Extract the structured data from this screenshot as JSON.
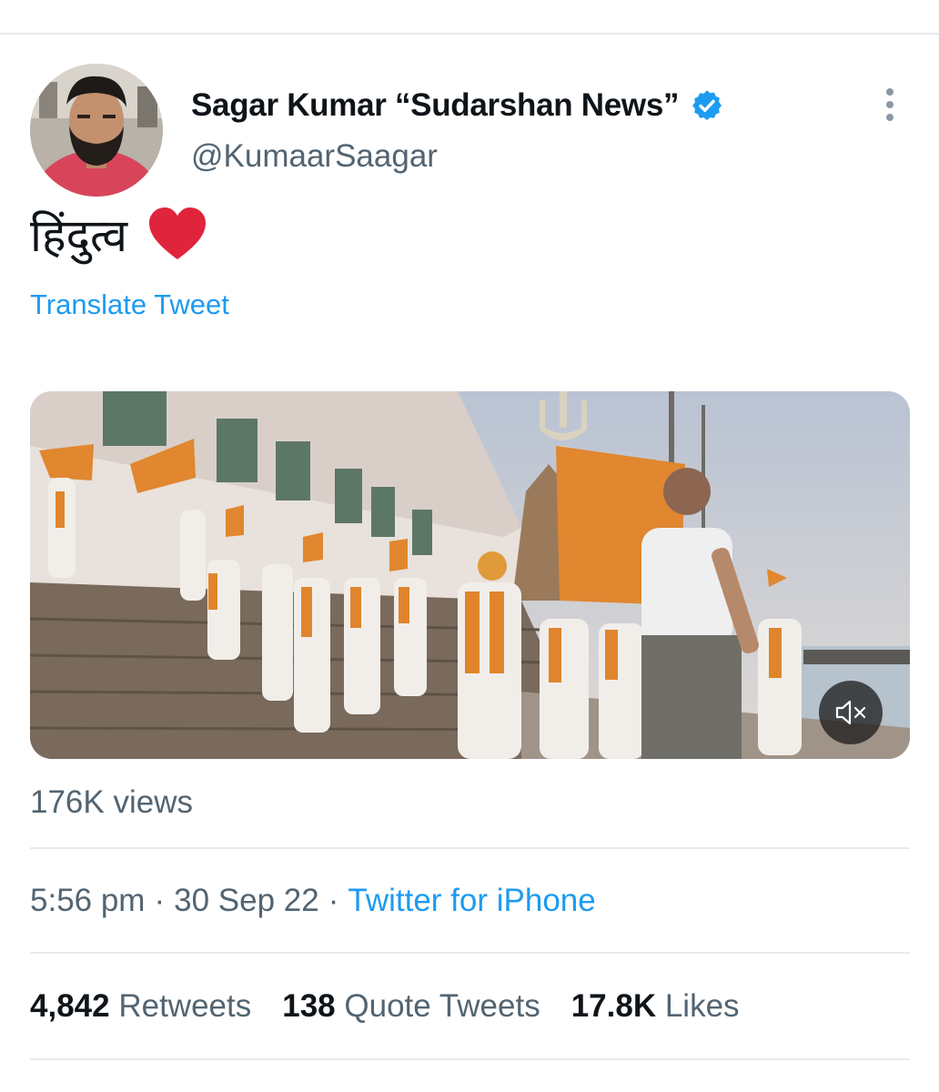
{
  "tweet": {
    "author": {
      "display_name": "Sagar Kumar “Sudarshan News”",
      "handle": "@KumaarSaagar",
      "verified": true,
      "verified_color": "#1d9bf0"
    },
    "text": "हिंदुत्व",
    "text_emoji": "red-heart-emoji",
    "translate_label": "Translate Tweet",
    "media": {
      "type": "video",
      "muted": true,
      "mute_icon": "speaker-muted-icon"
    },
    "views": "176K views",
    "time": "5:56 pm",
    "separator": "·",
    "date": "30 Sep 22",
    "source": "Twitter for iPhone",
    "stats": {
      "retweets_count": "4,842",
      "retweets_label": "Retweets",
      "quotes_count": "138",
      "quotes_label": "Quote Tweets",
      "likes_count": "17.8K",
      "likes_label": "Likes"
    }
  },
  "colors": {
    "link_blue": "#1d9bf0",
    "secondary_text": "#536471",
    "heart_red": "#e0243b",
    "divider": "#e6ebef"
  }
}
